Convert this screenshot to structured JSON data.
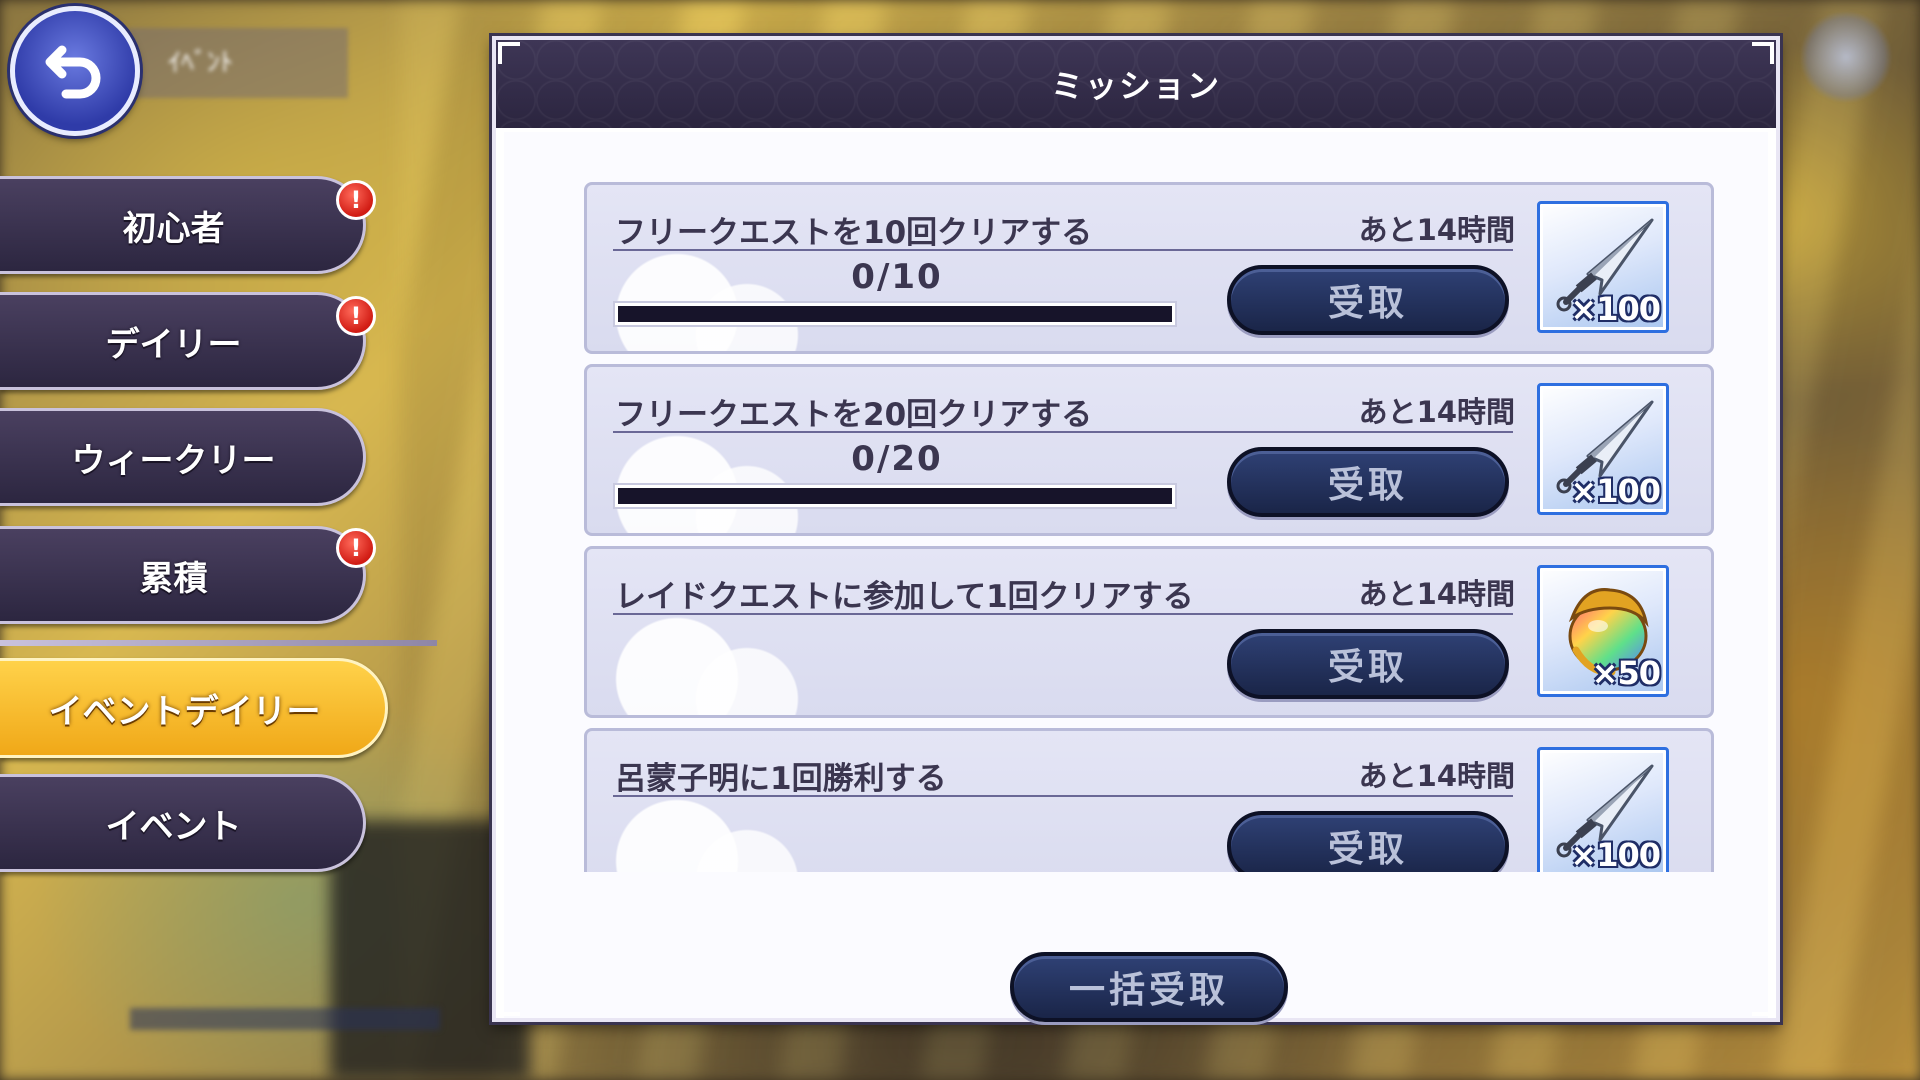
{
  "window": {
    "title": "ミッション"
  },
  "back_label": "ｲﾍﾞﾝﾄ",
  "sidebar": {
    "tabs": [
      {
        "label": "初心者",
        "alert": "!"
      },
      {
        "label": "デイリー",
        "alert": "!"
      },
      {
        "label": "ウィークリー"
      },
      {
        "label": "累積",
        "alert": "!"
      },
      {
        "label": "イベントデイリー",
        "active": true
      },
      {
        "label": "イベント"
      }
    ]
  },
  "missions": [
    {
      "title": "フリークエストを10回クリアする",
      "time": "あと14時間",
      "progress": "0/10",
      "progress_fraction": 0,
      "claim": "受取",
      "reward": {
        "icon": "kunai-icon",
        "count": "×100"
      }
    },
    {
      "title": "フリークエストを20回クリアする",
      "time": "あと14時間",
      "progress": "0/20",
      "progress_fraction": 0,
      "claim": "受取",
      "reward": {
        "icon": "kunai-icon",
        "count": "×100"
      }
    },
    {
      "title": "レイドクエストに参加して1回クリアする",
      "time": "あと14時間",
      "claim": "受取",
      "reward": {
        "icon": "gem-orb-icon",
        "count": "×50"
      }
    },
    {
      "title": "呂蒙子明に1回勝利する",
      "time": "あと14時間",
      "claim": "受取",
      "reward": {
        "icon": "kunai-icon",
        "count": "×100"
      }
    }
  ],
  "bulk_claim": "一括受取",
  "colors": {
    "active_tab": "#f0a818",
    "header": "#2b253f",
    "button": "#1a2548",
    "alert": "#d11c14"
  }
}
